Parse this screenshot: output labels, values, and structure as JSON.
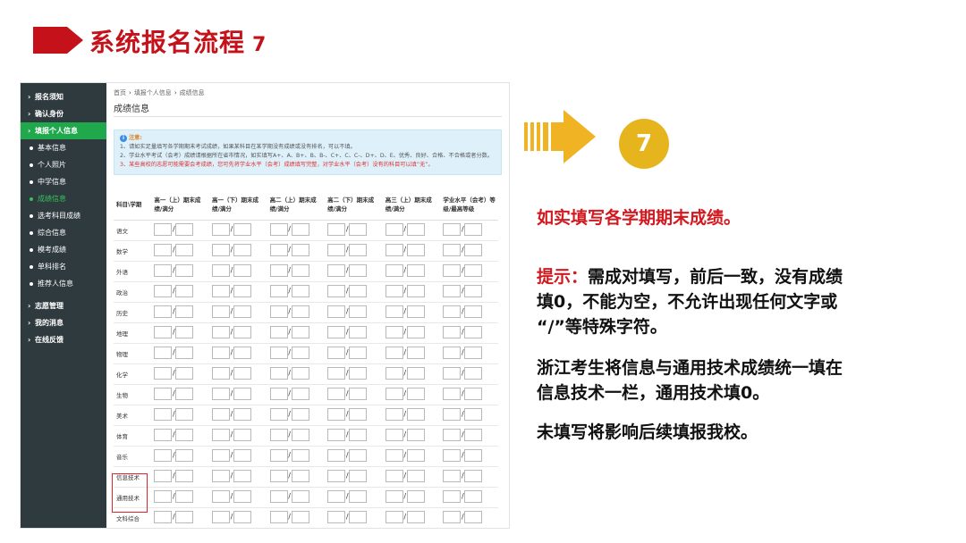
{
  "header": {
    "title": "系统报名流程",
    "step": "7"
  },
  "sidebar": {
    "items": [
      {
        "label": "报名须知",
        "kind": "section"
      },
      {
        "label": "确认身份",
        "kind": "section"
      },
      {
        "label": "填报个人信息",
        "kind": "section-active"
      },
      {
        "label": "基本信息",
        "kind": "sub"
      },
      {
        "label": "个人照片",
        "kind": "sub"
      },
      {
        "label": "中学信息",
        "kind": "sub"
      },
      {
        "label": "成绩信息",
        "kind": "sub-current"
      },
      {
        "label": "选考科目成绩",
        "kind": "sub"
      },
      {
        "label": "综合信息",
        "kind": "sub"
      },
      {
        "label": "模考成绩",
        "kind": "sub"
      },
      {
        "label": "单科排名",
        "kind": "sub"
      },
      {
        "label": "推荐人信息",
        "kind": "sub"
      },
      {
        "label": "志愿管理",
        "kind": "section"
      },
      {
        "label": "我的消息",
        "kind": "section"
      },
      {
        "label": "在线反馈",
        "kind": "section"
      }
    ]
  },
  "breadcrumb": {
    "home": "首页",
    "parent": "填报个人信息",
    "current": "成绩信息"
  },
  "page_title": "成绩信息",
  "notice": {
    "title": "注意:",
    "line1": "1、请如实足量填写各学期期末考试成绩，如果某科目在某学期没有成绩或没有排名，可以不填。",
    "line2": "2、学业水平考试（会考）成绩请根据所在省市情况，如实填写A+、A、B+、B、B-、C+、C、C-、D+、D、E、优秀、良好、合格、不合格或者分数。",
    "line3": "3、某些高校的志愿可能需要会考成绩，您可先将学业水平（会考）成绩填写完整，对学业水平（会考）没有的科目可以填“无”。"
  },
  "table": {
    "headers": [
      "科目\\学期",
      "高一（上）期末成绩/满分",
      "高一（下）期末成绩/满分",
      "高二（上）期末成绩/满分",
      "高二（下）期末成绩/满分",
      "高三（上）期末成绩/满分",
      "学业水平（会考）等级/最高等级"
    ],
    "subjects": [
      "语文",
      "数学",
      "外语",
      "政治",
      "历史",
      "地理",
      "物理",
      "化学",
      "生物",
      "美术",
      "体育",
      "音乐",
      "信息技术",
      "通用技术",
      "文科综合"
    ]
  },
  "right": {
    "step": "7",
    "main": "如实填写各学期期末成绩。",
    "tip_label": "提示：",
    "tip_l1": "需成对填写，前后一致，没有成绩",
    "tip_l2": "填0，不能为空，不允许出现任何文字或",
    "tip_l3": "“/”等特殊字符。",
    "zj_l1": "浙江考生将信息与通用技术成绩统一填在",
    "zj_l2": "信息技术一栏，通用技术填0。",
    "last": "未填写将影响后续填报我校。"
  },
  "colors": {
    "brand_red": "#c5121a",
    "sidebar_bg": "#2e3a3e",
    "active_green": "#20a84d",
    "accent_gold": "#e6b41d"
  }
}
